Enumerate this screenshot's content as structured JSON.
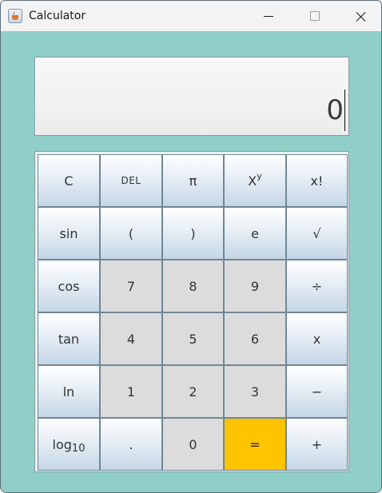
{
  "window": {
    "title": "Calculator",
    "icon": "java-cup-icon"
  },
  "display": {
    "value": "0"
  },
  "colors": {
    "background": "#8fcfc7",
    "key_gradient_top": "#ffffff",
    "key_gradient_bottom": "#c4d6e6",
    "number_key": "#dcdcdc",
    "equals_key": "#ffc300"
  },
  "keys": [
    [
      "C",
      "DEL",
      "π",
      "XY",
      "x!"
    ],
    [
      "sin",
      "(",
      ")",
      "e",
      "√"
    ],
    [
      "cos",
      "7",
      "8",
      "9",
      "÷"
    ],
    [
      "tan",
      "4",
      "5",
      "6",
      "x"
    ],
    [
      "ln",
      "1",
      "2",
      "3",
      "−"
    ],
    [
      "log10",
      ".",
      "0",
      "=",
      "+"
    ]
  ],
  "labels": {
    "clear": "C",
    "delete": "DEL",
    "pi": "π",
    "power_base": "X",
    "power_exp": "y",
    "factorial": "x!",
    "sin": "sin",
    "paren_open": "(",
    "paren_close": ")",
    "e": "e",
    "sqrt": "√",
    "cos": "cos",
    "n7": "7",
    "n8": "8",
    "n9": "9",
    "divide": "÷",
    "tan": "tan",
    "n4": "4",
    "n5": "5",
    "n6": "6",
    "multiply": "x",
    "ln": "ln",
    "n1": "1",
    "n2": "2",
    "n3": "3",
    "minus": "−",
    "log_base": "log",
    "log_sub": "10",
    "dot": ".",
    "n0": "0",
    "equals": "=",
    "plus": "+"
  }
}
